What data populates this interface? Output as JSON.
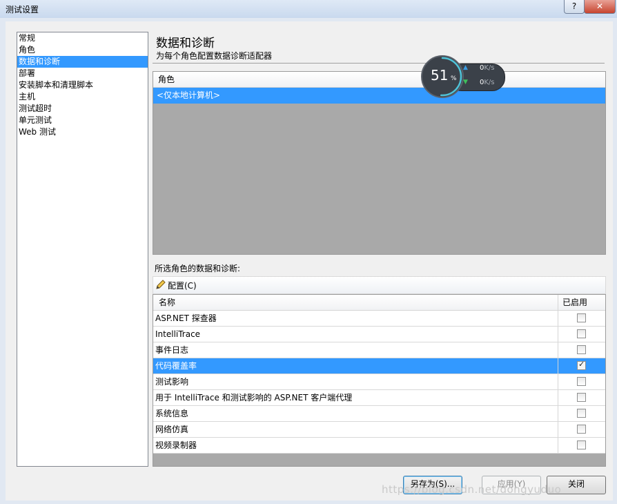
{
  "window": {
    "title": "测试设置",
    "help_label": "?",
    "close_label": "✕"
  },
  "nav": {
    "items": [
      {
        "label": "常规"
      },
      {
        "label": "角色"
      },
      {
        "label": "数据和诊断",
        "selected": true
      },
      {
        "label": "部署"
      },
      {
        "label": "安装脚本和清理脚本"
      },
      {
        "label": "主机"
      },
      {
        "label": "测试超时"
      },
      {
        "label": "单元测试"
      },
      {
        "label": "Web 测试"
      }
    ]
  },
  "page": {
    "title": "数据和诊断",
    "subtitle": "为每个角色配置数据诊断适配器"
  },
  "roles_grid": {
    "header": "角色",
    "rows": [
      "<仅本地计算机>"
    ]
  },
  "diagnostics": {
    "section_label": "所选角色的数据和诊断:",
    "configure_label": "配置(C)",
    "configure_icon": "pencil-icon",
    "col_name": "名称",
    "col_enabled": "已启用",
    "rows": [
      {
        "name": "ASP.NET 探查器",
        "enabled": false,
        "selected": false
      },
      {
        "name": "IntelliTrace",
        "enabled": false,
        "selected": false
      },
      {
        "name": "事件日志",
        "enabled": false,
        "selected": false
      },
      {
        "name": "代码覆盖率",
        "enabled": true,
        "selected": true
      },
      {
        "name": "测试影响",
        "enabled": false,
        "selected": false
      },
      {
        "name": "用于 IntelliTrace 和测试影响的 ASP.NET 客户端代理",
        "enabled": false,
        "selected": false
      },
      {
        "name": "系统信息",
        "enabled": false,
        "selected": false
      },
      {
        "name": "网络仿真",
        "enabled": false,
        "selected": false
      },
      {
        "name": "视频录制器",
        "enabled": false,
        "selected": false
      }
    ]
  },
  "buttons": {
    "save_as": "另存为(S)...",
    "apply": "应用(Y)",
    "close": "关闭"
  },
  "net_monitor": {
    "percent": "51",
    "percent_sign": "%",
    "percent_value": 0.51,
    "up_value": "0",
    "down_value": "0",
    "unit": "K/s",
    "up_icon": "arrow-up-icon",
    "down_icon": "arrow-down-icon"
  },
  "watermark": "https://blog.csdn.net/dongyuduo"
}
